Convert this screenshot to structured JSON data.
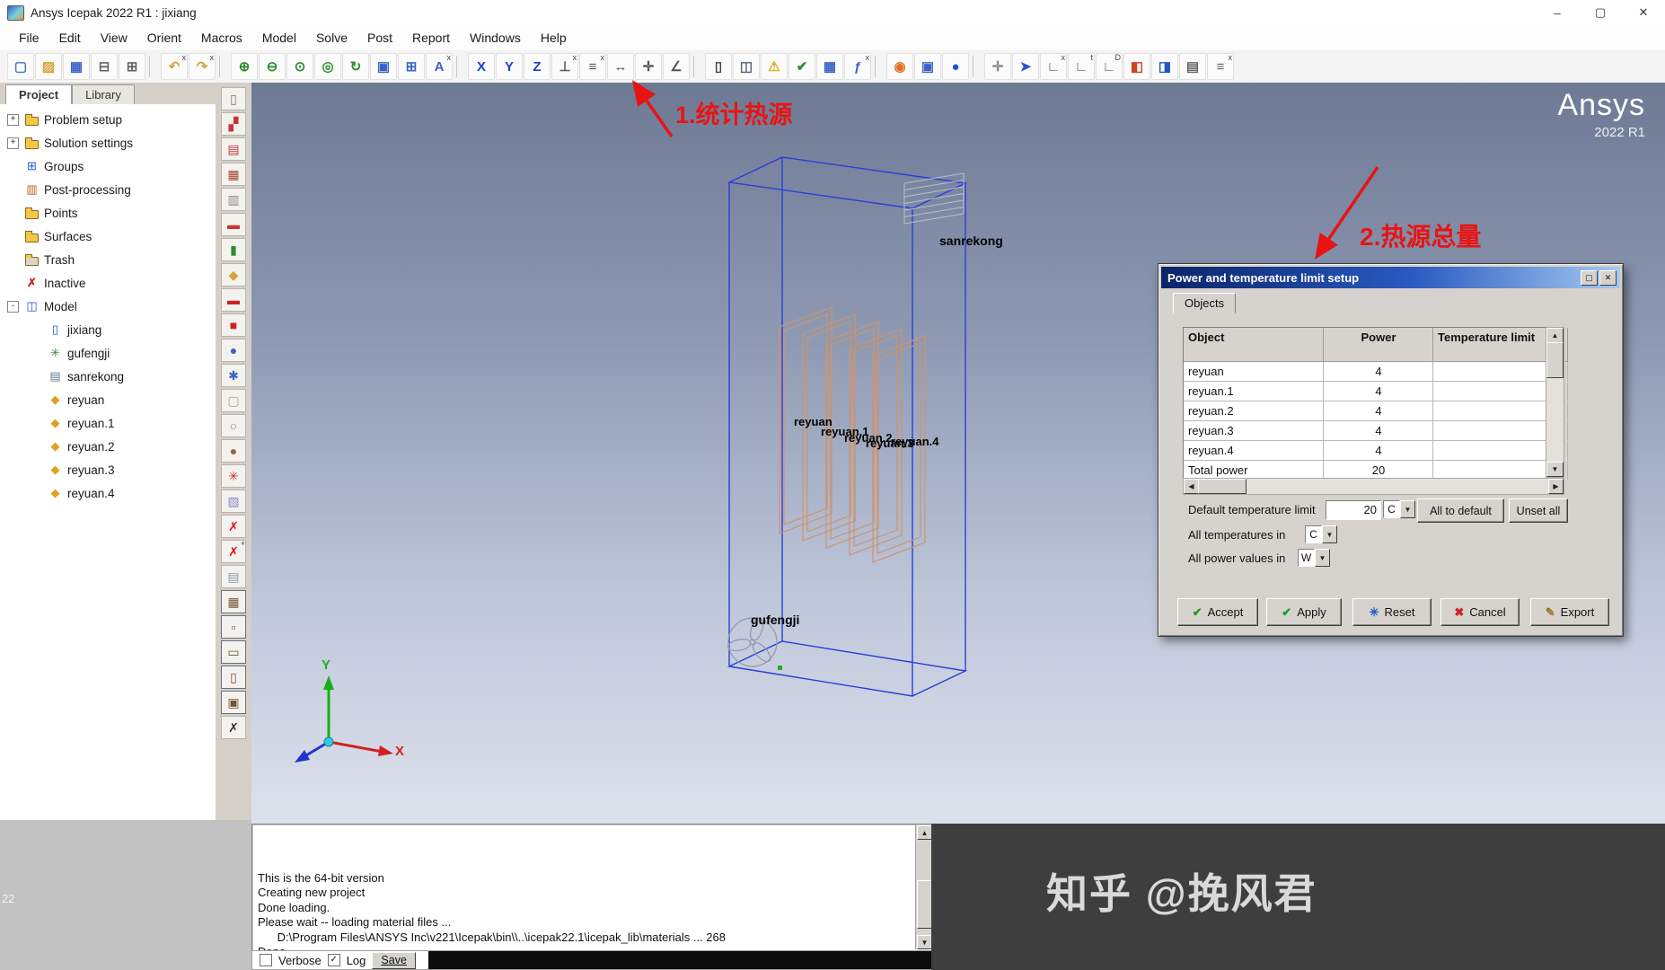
{
  "window": {
    "title": "Ansys Icepak 2022 R1 : jixiang",
    "controls": [
      {
        "name": "minimize-button",
        "glyph": "–"
      },
      {
        "name": "maximize-button",
        "glyph": "▢"
      },
      {
        "name": "close-button",
        "glyph": "✕"
      }
    ]
  },
  "menu": {
    "items": [
      "File",
      "Edit",
      "View",
      "Orient",
      "Macros",
      "Model",
      "Solve",
      "Post",
      "Report",
      "Windows",
      "Help"
    ]
  },
  "toolbar": {
    "items": [
      {
        "name": "new-file-icon",
        "glyph": "▢",
        "color": "#4a6fd0"
      },
      {
        "name": "open-folder-icon",
        "glyph": "▨",
        "color": "#d8a23a"
      },
      {
        "name": "save-icon",
        "glyph": "▦",
        "color": "#3a62c8"
      },
      {
        "name": "print-icon",
        "glyph": "⊟",
        "color": "#666666"
      },
      {
        "name": "print-preview-icon",
        "glyph": "⊞",
        "color": "#666666"
      },
      {
        "cls": "sep"
      },
      {
        "name": "undo-icon",
        "glyph": "↶",
        "color": "#d8a23a",
        "sup": "x"
      },
      {
        "name": "redo-icon",
        "glyph": "↷",
        "color": "#d8a23a",
        "sup": "x"
      },
      {
        "cls": "sep"
      },
      {
        "name": "zoom-in-icon",
        "glyph": "⊕",
        "color": "#2e8b2e"
      },
      {
        "name": "zoom-out-icon",
        "glyph": "⊖",
        "color": "#2e8b2e"
      },
      {
        "name": "zoom-previous-icon",
        "glyph": "⊙",
        "color": "#2e8b2e"
      },
      {
        "name": "scale-to-fit-icon",
        "glyph": "◎",
        "color": "#2e8b2e"
      },
      {
        "name": "rotate-view-icon",
        "glyph": "↻",
        "color": "#2e8b2e"
      },
      {
        "name": "front-view-icon",
        "glyph": "▣",
        "color": "#3a62c8"
      },
      {
        "name": "grid-view-icon",
        "glyph": "⊞",
        "color": "#3a62c8"
      },
      {
        "name": "annotation-text-icon",
        "glyph": "A",
        "color": "#3a62c8",
        "sup": "x"
      },
      {
        "cls": "sep"
      },
      {
        "name": "axis-x-icon",
        "glyph": "X",
        "color": "#1a3fd0"
      },
      {
        "name": "axis-y-icon",
        "glyph": "Y",
        "color": "#1a3fd0"
      },
      {
        "name": "axis-z-icon",
        "glyph": "Z",
        "color": "#1a3fd0"
      },
      {
        "name": "align-face-icon",
        "glyph": "⊥",
        "color": "#555555",
        "sup": "x"
      },
      {
        "name": "align-center-icon",
        "glyph": "≡",
        "color": "#555555",
        "sup": "x"
      },
      {
        "name": "measure-icon",
        "glyph": "↔",
        "color": "#555555"
      },
      {
        "name": "snap-icon",
        "glyph": "✛",
        "color": "#555555"
      },
      {
        "name": "angle-icon",
        "glyph": "∠",
        "color": "#555555"
      },
      {
        "cls": "sep"
      },
      {
        "name": "power-temperature-setup-icon",
        "glyph": "▯",
        "color": "#444444"
      },
      {
        "name": "model-3d-icon",
        "glyph": "◫",
        "color": "#556677"
      },
      {
        "name": "check-model-icon",
        "glyph": "⚠",
        "color": "#e0a810"
      },
      {
        "name": "validate-icon",
        "glyph": "✔",
        "color": "#2e8b2e"
      },
      {
        "name": "summary-table-icon",
        "glyph": "▦",
        "color": "#3a62c8"
      },
      {
        "name": "function-fx-icon",
        "glyph": "ƒ",
        "color": "#3a62c8",
        "sup": "x"
      },
      {
        "cls": "sep"
      },
      {
        "name": "orbit-icon",
        "glyph": "◉",
        "color": "#e07020"
      },
      {
        "name": "probe-icon",
        "glyph": "▣",
        "color": "#3a62c8"
      },
      {
        "name": "globe-icon",
        "glyph": "●",
        "color": "#2255cc"
      },
      {
        "cls": "sep"
      },
      {
        "name": "move-tool-icon",
        "glyph": "✛",
        "color": "#888888"
      },
      {
        "name": "select-arrow-icon",
        "glyph": "➤",
        "color": "#2255cc"
      },
      {
        "name": "edit-plane-x-icon",
        "glyph": "∟",
        "color": "#555555",
        "sup": "x"
      },
      {
        "name": "edit-plane-t-icon",
        "glyph": "∟",
        "color": "#555555",
        "sup": "t"
      },
      {
        "name": "edit-plane-d-icon",
        "glyph": "∟",
        "color": "#555555",
        "sup": "D"
      },
      {
        "name": "copy-object-icon",
        "glyph": "◧",
        "color": "#cc4422"
      },
      {
        "name": "move-object-icon",
        "glyph": "◨",
        "color": "#2255cc"
      },
      {
        "name": "report-doc-icon",
        "glyph": "▤",
        "color": "#666666"
      },
      {
        "name": "preferences-icon",
        "glyph": "≡",
        "color": "#666666",
        "sup": "x"
      }
    ]
  },
  "side_toolbar": {
    "items": [
      {
        "name": "cabinet-tool-icon",
        "glyph": "▯",
        "color": "#777777"
      },
      {
        "name": "assembly-tool-icon",
        "glyph": "▞",
        "color": "#cc3333"
      },
      {
        "name": "heat-exchanger-tool-icon",
        "glyph": "▤",
        "color": "#cc3333"
      },
      {
        "name": "grille-tool-icon",
        "glyph": "▦",
        "color": "#aa4433"
      },
      {
        "name": "opening-tool-icon",
        "glyph": "▥",
        "color": "#888888"
      },
      {
        "name": "plate-tool-icon",
        "glyph": "▬",
        "color": "#cc3333"
      },
      {
        "name": "enclosure-tool-icon",
        "glyph": "▮",
        "color": "#2e8b2e"
      },
      {
        "name": "source-tool-icon",
        "glyph": "◆",
        "color": "#d8a23a"
      },
      {
        "name": "resistance-tool-icon",
        "glyph": "▬",
        "color": "#cc2222"
      },
      {
        "name": "block-tool-icon",
        "glyph": "■",
        "color": "#cc2222"
      },
      {
        "name": "disc-tool-icon",
        "glyph": "●",
        "color": "#3a62c8"
      },
      {
        "name": "gear-tool-icon",
        "glyph": "✱",
        "color": "#3a62c8"
      },
      {
        "name": "plate-pale-tool-icon",
        "glyph": "▢",
        "color": "#99aa88"
      },
      {
        "name": "cylinder-tool-icon",
        "glyph": "○",
        "color": "#888888"
      },
      {
        "name": "sphere-tool-icon",
        "glyph": "●",
        "color": "#996633"
      },
      {
        "name": "fan-tool-icon",
        "glyph": "✳",
        "color": "#cc3333"
      },
      {
        "name": "pcb-tool-icon",
        "glyph": "▧",
        "color": "#8888cc"
      },
      {
        "name": "delete-object-icon",
        "glyph": "✗",
        "color": "#dd1111"
      },
      {
        "name": "delete-all-icon",
        "glyph": "✗",
        "color": "#dd1111",
        "sup": "+"
      },
      {
        "name": "copy-sheet-icon",
        "glyph": "▤",
        "color": "#8899aa"
      },
      {
        "name": "mesh-region-icon",
        "glyph": "▦",
        "color": "#775533",
        "cls": "boxed"
      },
      {
        "name": "point-monitor-icon",
        "glyph": "▫",
        "color": "#775533",
        "cls": "boxed"
      },
      {
        "name": "surface-monitor-icon",
        "glyph": "▭",
        "color": "#775533",
        "cls": "boxed"
      },
      {
        "name": "trace-region-icon",
        "glyph": "▯",
        "color": "#775533",
        "cls": "boxed"
      },
      {
        "name": "zoom-region-icon",
        "glyph": "▣",
        "color": "#775533",
        "cls": "boxed"
      },
      {
        "name": "strip-close-icon",
        "glyph": "✗",
        "color": "#333333"
      }
    ]
  },
  "project": {
    "tabs": [
      "Project",
      "Library"
    ],
    "tree": [
      {
        "label": "Problem setup",
        "icon": "ic-folder",
        "toggle": "+",
        "ind": "ind0",
        "name": "tree-item-problem-setup"
      },
      {
        "label": "Solution settings",
        "icon": "ic-folder",
        "toggle": "+",
        "ind": "ind0",
        "name": "tree-item-solution-settings"
      },
      {
        "label": "Groups",
        "icon": "ic-groups",
        "toggle": "",
        "ind": "ind0",
        "name": "tree-item-groups"
      },
      {
        "label": "Post-processing",
        "icon": "ic-post",
        "toggle": "",
        "ind": "ind0",
        "name": "tree-item-post-processing"
      },
      {
        "label": "Points",
        "icon": "ic-folder",
        "toggle": "",
        "ind": "ind0",
        "name": "tree-item-points"
      },
      {
        "label": "Surfaces",
        "icon": "ic-folder",
        "toggle": "",
        "ind": "ind0",
        "name": "tree-item-surfaces"
      },
      {
        "label": "Trash",
        "icon": "ic-trash",
        "toggle": "",
        "ind": "ind0",
        "name": "tree-item-trash"
      },
      {
        "label": "Inactive",
        "icon": "ic-inactive",
        "toggle": "",
        "ind": "ind0",
        "name": "tree-item-inactive"
      },
      {
        "label": "Model",
        "icon": "ic-model",
        "toggle": "-",
        "ind": "ind0",
        "name": "tree-item-model"
      },
      {
        "label": "jixiang",
        "icon": "ic-cabinet",
        "toggle": "",
        "ind": "ind1",
        "name": "tree-item-jixiang"
      },
      {
        "label": "gufengji",
        "icon": "ic-fan",
        "toggle": "",
        "ind": "ind1",
        "name": "tree-item-gufengji"
      },
      {
        "label": "sanrekong",
        "icon": "ic-grille",
        "toggle": "",
        "ind": "ind1",
        "name": "tree-item-sanrekong"
      },
      {
        "label": "reyuan",
        "icon": "ic-source",
        "toggle": "",
        "ind": "ind1",
        "name": "tree-item-reyuan"
      },
      {
        "label": "reyuan.1",
        "icon": "ic-source",
        "toggle": "",
        "ind": "ind1",
        "name": "tree-item-reyuan-1"
      },
      {
        "label": "reyuan.2",
        "icon": "ic-source",
        "toggle": "",
        "ind": "ind1",
        "name": "tree-item-reyuan-2"
      },
      {
        "label": "reyuan.3",
        "icon": "ic-source",
        "toggle": "",
        "ind": "ind1",
        "name": "tree-item-reyuan-3"
      },
      {
        "label": "reyuan.4",
        "icon": "ic-source",
        "toggle": "",
        "ind": "ind1",
        "name": "tree-item-reyuan-4"
      }
    ]
  },
  "canvas": {
    "brand_name": "Ansys",
    "brand_version": "2022 R1",
    "labels": {
      "sanrekong": "sanrekong",
      "reyuan": "reyuan",
      "reyuan1": "reyuan.1",
      "reyuan2": "reyuan.2",
      "reyuan3": "reyuan.3",
      "reyuan4": "reyuan.4",
      "gufengji": "gufengji"
    },
    "axes": {
      "x": "X",
      "y": "Y"
    },
    "annotations": {
      "first": "1.统计热源",
      "second": "2.热源总量"
    }
  },
  "dialog": {
    "title": "Power and temperature limit setup",
    "controls": [
      {
        "name": "dialog-maximize-button",
        "glyph": "▢"
      },
      {
        "name": "dialog-close-button",
        "glyph": "✕"
      }
    ],
    "tab": "Objects",
    "table": {
      "headers": [
        "Object",
        "Power",
        "Temperature limit"
      ],
      "rows": [
        {
          "object": "reyuan",
          "power": "4",
          "temp": "",
          "name": "table-row-reyuan"
        },
        {
          "object": "reyuan.1",
          "power": "4",
          "temp": "",
          "name": "table-row-reyuan-1"
        },
        {
          "object": "reyuan.2",
          "power": "4",
          "temp": "",
          "name": "table-row-reyuan-2"
        },
        {
          "object": "reyuan.3",
          "power": "4",
          "temp": "",
          "name": "table-row-reyuan-3"
        },
        {
          "object": "reyuan.4",
          "power": "4",
          "temp": "",
          "name": "table-row-reyuan-4"
        },
        {
          "object": "Total power",
          "power": "20",
          "temp": "",
          "name": "table-row-total-power"
        }
      ]
    },
    "default_temp": {
      "label": "Default temperature limit",
      "value": "20",
      "unit": "C"
    },
    "all_to_default_label": "All to default",
    "unset_all_label": "Unset all",
    "all_temps": {
      "label": "All temperatures in",
      "unit": "C"
    },
    "all_power": {
      "label": "All power values in",
      "unit": "W"
    },
    "buttons": [
      {
        "name": "accept-button",
        "label": "Accept",
        "glyph": "✔",
        "color": "#1f9a1f"
      },
      {
        "name": "apply-button",
        "label": "Apply",
        "glyph": "✔",
        "color": "#1f9a1f"
      },
      {
        "name": "reset-button",
        "label": "Reset",
        "glyph": "✳",
        "color": "#2255cc"
      },
      {
        "name": "cancel-button",
        "label": "Cancel",
        "glyph": "✖",
        "color": "#cc2222"
      },
      {
        "name": "export-button",
        "label": "Export",
        "glyph": "✎",
        "color": "#997722"
      }
    ]
  },
  "console": {
    "lines": [
      "This is the 64-bit version",
      "",
      "Creating new project",
      "Done loading.",
      "Please wait -- loading material files ...",
      "      D:\\Program Files\\ANSYS Inc\\v221\\Icepak\\bin\\\\..\\icepak22.1\\icepak_lib\\materials ... 268",
      "Done."
    ],
    "verbose_label": "Verbose",
    "log_label": "Log",
    "log_checked": "✓",
    "save_label": "Save"
  },
  "watermark": {
    "text": "知乎 @挽风君"
  },
  "misc": {
    "edge_label": "22"
  }
}
